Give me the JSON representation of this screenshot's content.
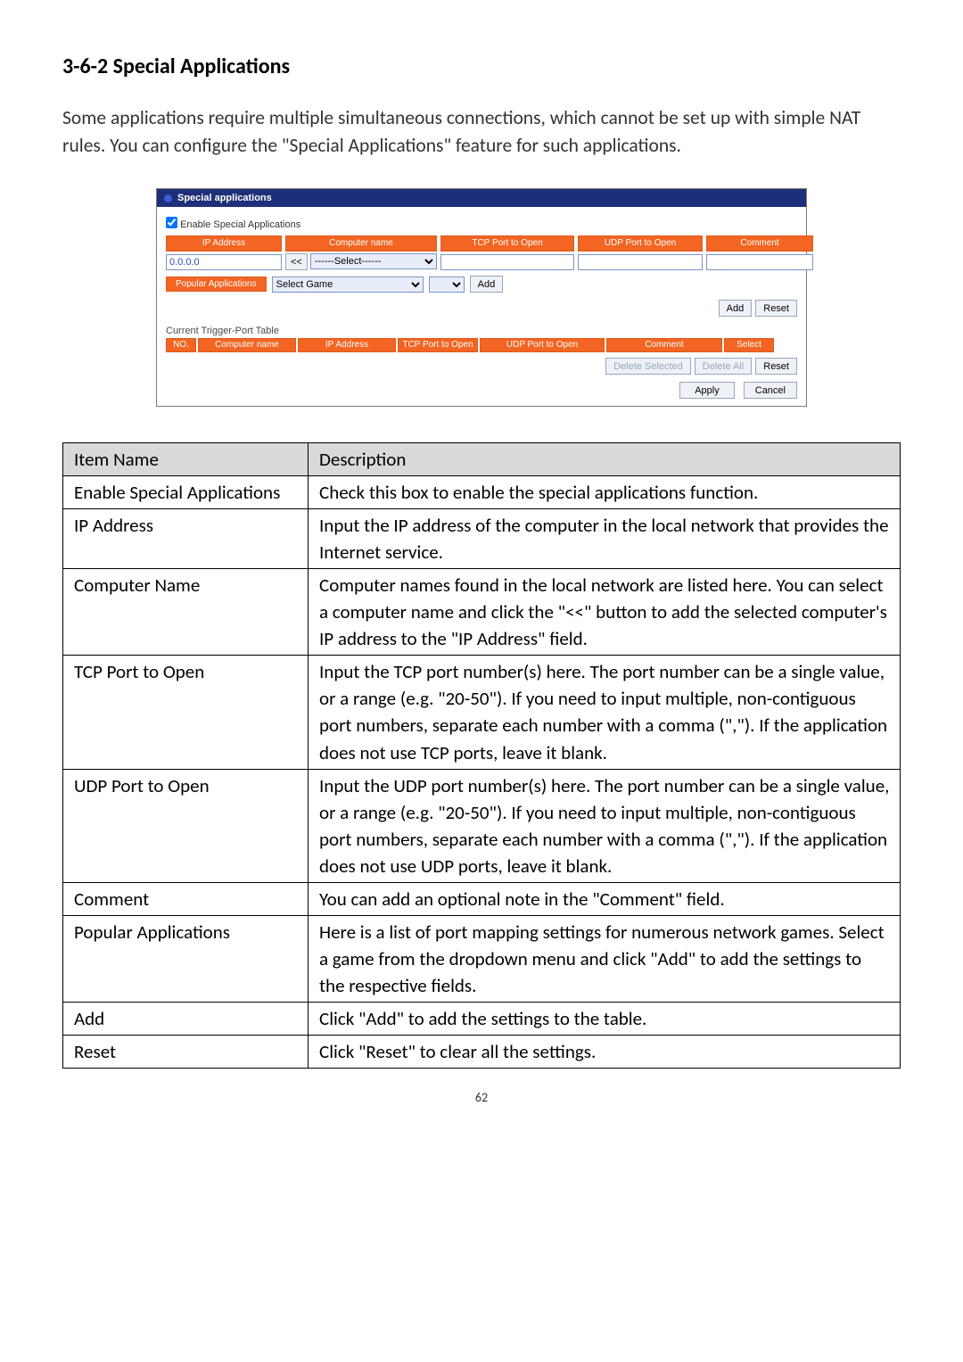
{
  "heading": "3-6-2 Special Applications",
  "intro": "Some applications require multiple simultaneous connections, which cannot be set up with simple NAT rules. You can configure the \"Special Applications\" feature for such applications.",
  "shot": {
    "panel_title": "Special applications",
    "enable_label": "Enable Special Applications",
    "hdr": {
      "ip": "IP Address",
      "cname": "Computer name",
      "tcp": "TCP Port to Open",
      "udp": "UDP Port to Open",
      "cmt": "Comment"
    },
    "ip_value": "0.0.0.0",
    "lt_btn": "<<",
    "select_placeholder": "------Select------",
    "pop_label": "Popular Applications",
    "select_game": "Select Game",
    "add_btn": "Add",
    "add_btn2": "Add",
    "reset_btn": "Reset",
    "cur_lbl": "Current Trigger-Port Table",
    "tbl2": {
      "no": "NO.",
      "cname": "Computer name",
      "ip": "IP Address",
      "tcp": "TCP Port to Open",
      "udp": "UDP Port to Open",
      "cmt": "Comment",
      "sel": "Select"
    },
    "del_sel": "Delete Selected",
    "del_all": "Delete All",
    "reset2": "Reset",
    "apply": "Apply",
    "cancel": "Cancel"
  },
  "table": {
    "head_item": "Item Name",
    "head_desc": "Description",
    "rows": [
      {
        "name": "Enable Special Applications",
        "desc": "Check this box to enable the special applications function."
      },
      {
        "name": "IP Address",
        "desc": "Input the IP address of the computer in the local network that provides the Internet service."
      },
      {
        "name": "Computer Name",
        "desc": "Computer names found in the local network are listed here. You can select a computer name and click the \"<<\" button to add the selected computer's IP address to the \"IP Address\" field."
      },
      {
        "name": "TCP Port to Open",
        "desc": "Input the TCP port number(s) here. The port number can be a single value, or a range (e.g. \"20-50\"). If you need to input multiple, non-contiguous port numbers, separate each number with a comma (\",\"). If the application does not use TCP ports, leave it blank."
      },
      {
        "name": "UDP Port to Open",
        "desc": "Input the UDP port number(s) here. The port number can be a single value, or a range (e.g. \"20-50\"). If you need to input multiple, non-contiguous port numbers, separate each number with a comma (\",\"). If the application does not use UDP ports, leave it blank."
      },
      {
        "name": "Comment",
        "desc": "You can add an optional note in the \"Comment\" field."
      },
      {
        "name": "Popular Applications",
        "desc": "Here is a list of port mapping settings for numerous network games. Select a game from the dropdown menu and click \"Add\" to add the settings to the respective fields."
      },
      {
        "name": "Add",
        "desc": "Click \"Add\" to add the settings to the table."
      },
      {
        "name": "Reset",
        "desc": "Click \"Reset\" to clear all the settings."
      }
    ]
  },
  "page_number": "62"
}
